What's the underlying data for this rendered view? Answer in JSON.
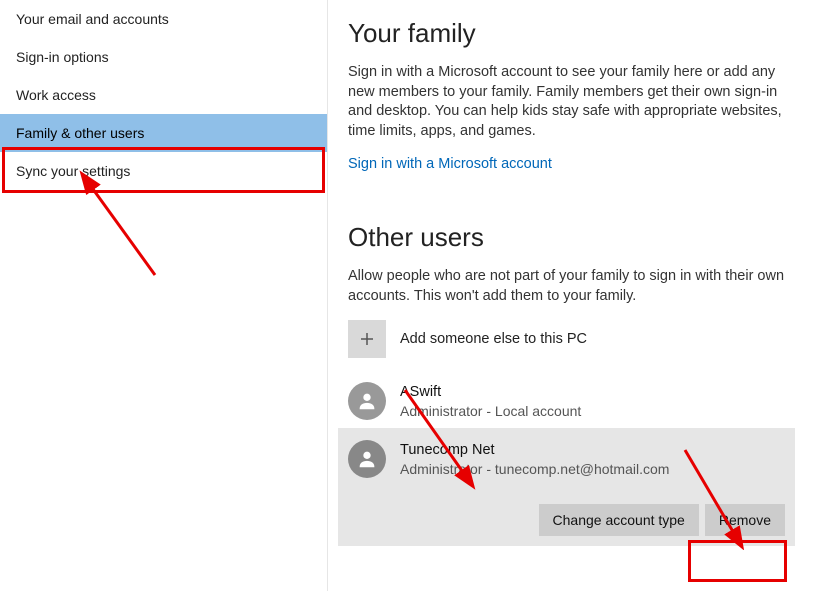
{
  "sidebar": {
    "items": [
      {
        "label": "Your email and accounts"
      },
      {
        "label": "Sign-in options"
      },
      {
        "label": "Work access"
      },
      {
        "label": "Family & other users"
      },
      {
        "label": "Sync your settings"
      }
    ]
  },
  "family": {
    "title": "Your family",
    "description": "Sign in with a Microsoft account to see your family here or add any new members to your family. Family members get their own sign-in and desktop. You can help kids stay safe with appropriate websites, time limits, apps, and games.",
    "link": "Sign in with a Microsoft account"
  },
  "other": {
    "title": "Other users",
    "description": "Allow people who are not part of your family to sign in with their own accounts. This won't add them to your family.",
    "add_label": "Add someone else to this PC",
    "users": [
      {
        "name": "ASwift",
        "sub": "Administrator - Local account"
      },
      {
        "name": "Tunecomp Net",
        "sub": "Administrator - tunecomp.net@hotmail.com"
      }
    ],
    "change_btn": "Change account type",
    "remove_btn": "Remove"
  }
}
